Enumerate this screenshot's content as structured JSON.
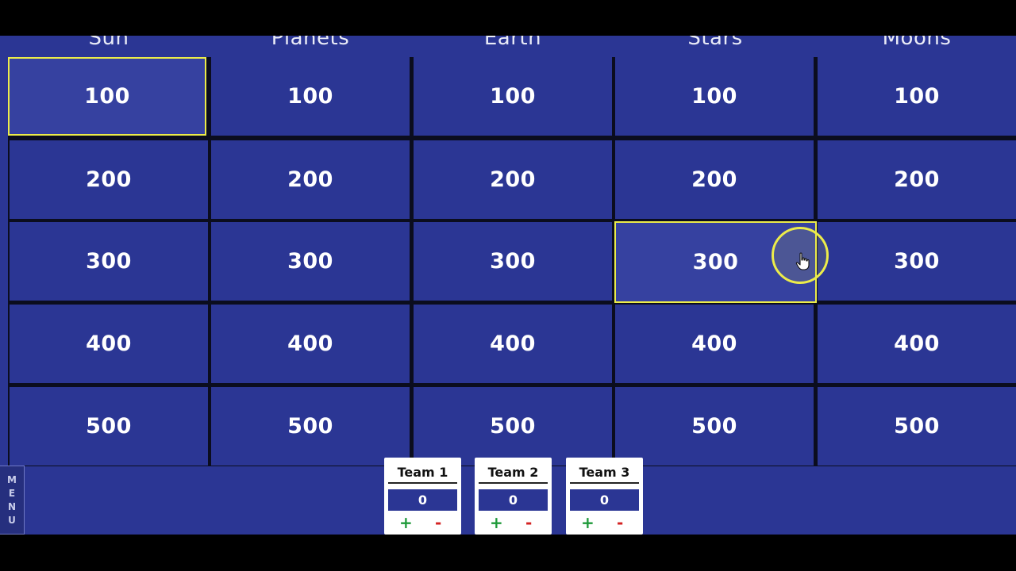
{
  "categories": [
    "Sun",
    "Planets",
    "Earth",
    "Stars",
    "Moons"
  ],
  "board": {
    "values": [
      [
        "100",
        "100",
        "100",
        "100",
        "100"
      ],
      [
        "200",
        "200",
        "200",
        "200",
        "200"
      ],
      [
        "300",
        "300",
        "300",
        "300",
        "300"
      ],
      [
        "400",
        "400",
        "400",
        "400",
        "400"
      ],
      [
        "500",
        "500",
        "500",
        "500",
        "500"
      ]
    ]
  },
  "menu": {
    "label": "MENU",
    "letters": [
      "M",
      "E",
      "N",
      "U"
    ]
  },
  "teams": [
    {
      "name": "Team 1",
      "score": "0",
      "plus": "+",
      "minus": "-"
    },
    {
      "name": "Team 2",
      "score": "0",
      "plus": "+",
      "minus": "-"
    },
    {
      "name": "Team 3",
      "score": "0",
      "plus": "+",
      "minus": "-"
    }
  ],
  "colors": {
    "board_blue": "#2b3694",
    "highlight_yellow": "#ecec4a",
    "plus_green": "#1f9a3a",
    "minus_red": "#d42222"
  }
}
